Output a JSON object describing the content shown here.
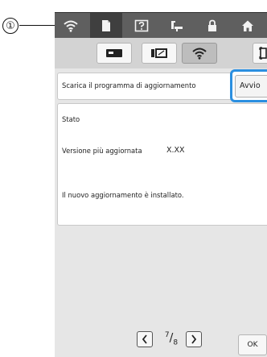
{
  "callout": {
    "number": "①"
  },
  "topbar": {
    "icons": [
      "wifi-icon",
      "document-icon",
      "help-icon",
      "sewing-machine-icon",
      "lock-icon",
      "home-icon"
    ],
    "active": "document-icon"
  },
  "tabs": {
    "items": [
      "machine-settings-icon",
      "embroidery-frame-icon",
      "wifi-icon"
    ],
    "selected": "wifi-icon"
  },
  "download": {
    "label": "Scarica il programma di aggiornamento",
    "button_label": "Avvio"
  },
  "status": {
    "heading": "Stato",
    "version_label": "Versione più aggiornata",
    "version_value": "X.XX",
    "message": "Il nuovo aggiornamento è installato."
  },
  "pager": {
    "current": "7",
    "total": "8"
  },
  "footer": {
    "ok_label": "OK"
  },
  "colors": {
    "highlight": "#2b8fe0",
    "topbar": "#5f5f5f",
    "screen_bg": "#e6e6e6"
  }
}
